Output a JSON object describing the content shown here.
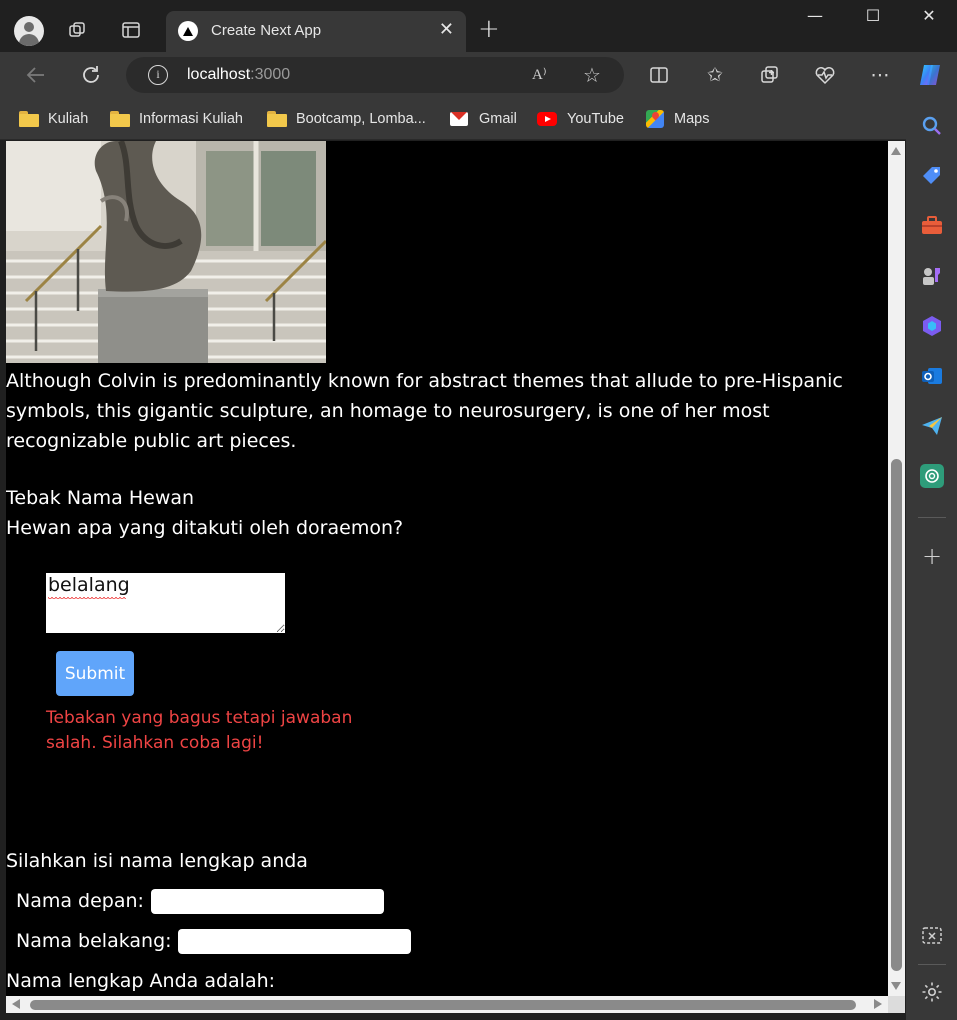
{
  "browser": {
    "tab_title": "Create Next App",
    "url_host": "localhost",
    "url_port": ":3000",
    "read_aloud_label": "A⁾"
  },
  "bookmarks": [
    {
      "label": "Kuliah",
      "icon": "folder-icon"
    },
    {
      "label": "Informasi Kuliah",
      "icon": "folder-icon"
    },
    {
      "label": "Bootcamp, Lomba...",
      "icon": "folder-icon"
    },
    {
      "label": "Gmail",
      "icon": "gmail-icon"
    },
    {
      "label": "YouTube",
      "icon": "youtube-icon"
    },
    {
      "label": "Maps",
      "icon": "maps-icon"
    }
  ],
  "page": {
    "description": "Although Colvin is predominantly known for abstract themes that allude to pre-Hispanic symbols, this gigantic sculpture, an homage to neurosurgery, is one of her most recognizable public art pieces.",
    "quiz": {
      "title": "Tebak Nama Hewan",
      "question": "Hewan apa yang ditakuti oleh doraemon?",
      "answer_value": "belalang",
      "submit_label": "Submit",
      "feedback": "Tebakan yang bagus tetapi jawaban salah. Silahkan coba lagi!"
    },
    "form": {
      "heading": "Silahkan isi nama lengkap anda",
      "first_name_label": "Nama depan:",
      "first_name_value": "",
      "last_name_label": "Nama belakang:",
      "last_name_value": "",
      "full_name_label": "Nama lengkap Anda adalah:"
    }
  },
  "colors": {
    "page_background": "#000000",
    "text": "#ffffff",
    "error_text": "#ef4444",
    "button": "#60a5fa",
    "browser_chrome": "#383838"
  }
}
